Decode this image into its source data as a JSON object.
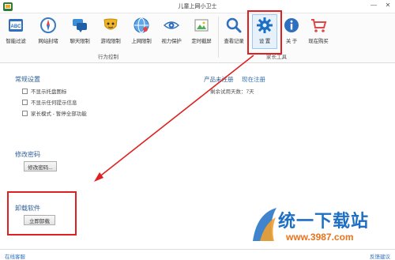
{
  "window": {
    "title": "儿童上网小卫士",
    "minimize_glyph": "—",
    "close_glyph": "✕"
  },
  "toolbar": {
    "behavior_group_label": "行为控制",
    "parent_group_label": "家长工具",
    "items": [
      {
        "label": "智能过滤",
        "icon": "abc-filter-icon"
      },
      {
        "label": "网站封堵",
        "icon": "compass-icon"
      },
      {
        "label": "聊天限制",
        "icon": "chat-icon"
      },
      {
        "label": "游戏限制",
        "icon": "mask-icon"
      },
      {
        "label": "上网限制",
        "icon": "globe-icon"
      },
      {
        "label": "视力保护",
        "icon": "eye-icon"
      },
      {
        "label": "定时截屏",
        "icon": "picture-icon"
      },
      {
        "label": "查看记录",
        "icon": "magnifier-icon"
      },
      {
        "label": "设  置",
        "icon": "gear-icon",
        "selected": true
      },
      {
        "label": "关  于",
        "icon": "info-icon"
      },
      {
        "label": "现在购买",
        "icon": "cart-icon"
      }
    ]
  },
  "general": {
    "title": "常规设置",
    "options": [
      {
        "label": "不显示托盘图标",
        "checked": false
      },
      {
        "label": "不显示任何提示信息",
        "checked": false
      },
      {
        "label": "家长模式 - 暂停全部功能",
        "checked": false
      }
    ]
  },
  "registration": {
    "status": "产品未注册",
    "link": "现在注册",
    "trial": "剩余试用天数：7天"
  },
  "password": {
    "title": "修改密码",
    "button": "修改密码..."
  },
  "uninstall": {
    "title": "卸载软件",
    "button": "立即卸载"
  },
  "footer": {
    "left": "在线客服",
    "right": "反馈建议"
  },
  "watermark": {
    "text": "统一下载站",
    "url": "www.3987.com"
  },
  "colors": {
    "accent_blue": "#2f6fb8",
    "highlight_red": "#e02020",
    "gear_blue": "#1d6fc4"
  }
}
